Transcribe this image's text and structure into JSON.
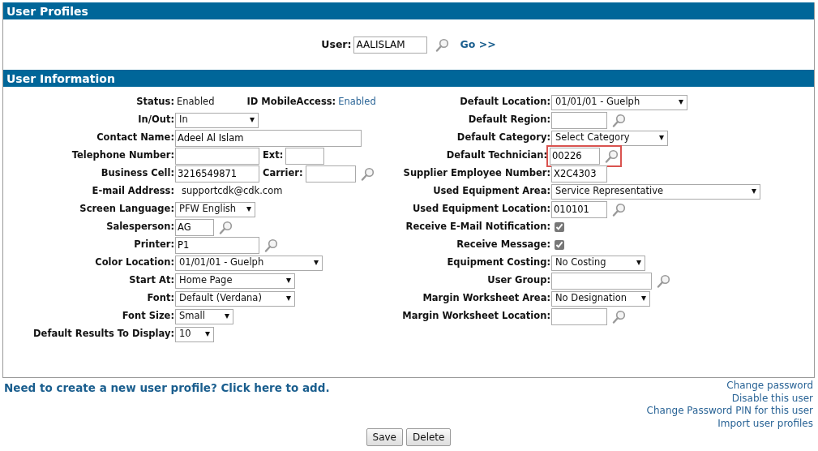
{
  "profiles_section": {
    "title": "User Profiles",
    "user_label": "User:",
    "user_value": "AALISLAM",
    "go_link": "Go >>"
  },
  "info_section": {
    "title": "User Information",
    "left_rows": [
      {
        "label": "Status:",
        "kind": "text",
        "value": "Enabled",
        "extra": {
          "label": "ID MobileAccess:",
          "kind": "link",
          "value": "Enabled"
        }
      },
      {
        "label": "In/Out:",
        "kind": "select",
        "value": "In"
      },
      {
        "label": "Contact Name:",
        "kind": "input",
        "value": "Adeel Al Islam"
      },
      {
        "label": "Telephone Number:",
        "kind": "input",
        "extra": {
          "label": "Ext:",
          "kind": "input"
        }
      },
      {
        "label": "Business Cell:",
        "kind": "input",
        "value": "3216549871",
        "extra": {
          "label": "Carrier:",
          "kind": "input",
          "lookup": true
        }
      },
      {
        "label": "E-mail Address:",
        "kind": "text",
        "value": "supportcdk@cdk.com"
      },
      {
        "label": "Screen Language:",
        "kind": "select",
        "value": "PFW English"
      },
      {
        "label": "Salesperson:",
        "kind": "input",
        "value": "AG",
        "lookup": true
      },
      {
        "label": "Printer:",
        "kind": "input",
        "value": "P1",
        "lookup": true
      },
      {
        "label": "Color Location:",
        "kind": "select",
        "value": "01/01/01 - Guelph"
      },
      {
        "label": "Start At:",
        "kind": "select",
        "value": "Home Page"
      },
      {
        "label": "Font:",
        "kind": "select",
        "value": "Default (Verdana)"
      },
      {
        "label": "Font Size:",
        "kind": "select",
        "value": "Small"
      },
      {
        "label": "Default Results To Display:",
        "kind": "select",
        "value": "10"
      }
    ],
    "right_rows": [
      {
        "label": "Default Location:",
        "kind": "select",
        "value": "01/01/01 - Guelph"
      },
      {
        "label": "Default Region:",
        "kind": "input",
        "lookup": true
      },
      {
        "label": "Default Category:",
        "kind": "select",
        "value": "Select Category"
      },
      {
        "label": "Default Technician:",
        "kind": "input",
        "value": "00226",
        "lookup": true,
        "highlighted": true
      },
      {
        "label": "Supplier Employee Number:",
        "kind": "input",
        "value": "X2C4303"
      },
      {
        "label": "Used Equipment Area:",
        "kind": "select",
        "value": "Service Representative"
      },
      {
        "label": "Used Equipment Location:",
        "kind": "input",
        "value": "010101",
        "lookup": true
      },
      {
        "label": "Receive E-Mail Notification:",
        "kind": "checkbox",
        "checked": true
      },
      {
        "label": "Receive Message:",
        "kind": "checkbox",
        "checked": true
      },
      {
        "label": "Equipment Costing:",
        "kind": "select",
        "value": "No Costing"
      },
      {
        "label": "User Group:",
        "kind": "input",
        "lookup": true
      },
      {
        "label": "Margin Worksheet Area:",
        "kind": "select",
        "value": "No Designation"
      },
      {
        "label": "Margin Worksheet Location:",
        "kind": "input",
        "lookup": true
      }
    ]
  },
  "create_link": "Need to create a new user profile? Click here to add.",
  "side_links": [
    "Change password",
    "Disable this user",
    "Change Password PIN for this user",
    "Import user profiles"
  ],
  "buttons": [
    "Save",
    "Delete"
  ]
}
